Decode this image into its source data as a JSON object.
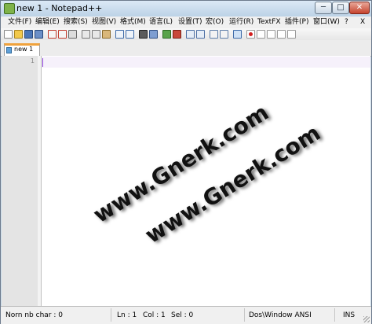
{
  "window": {
    "title": "new 1 - Notepad++"
  },
  "titlebar_buttons": {
    "minimize": "─",
    "maximize": "□",
    "close": "✕"
  },
  "menu": [
    "文件(F)",
    "编辑(E)",
    "搜索(S)",
    "视图(V)",
    "格式(M)",
    "语言(L)",
    "设置(T)",
    "宏(O)",
    "运行(R)",
    "TextFX",
    "插件(P)",
    "窗口(W)",
    "?",
    "X"
  ],
  "toolbar_icons": [
    "new-file-icon",
    "open-file-icon",
    "save-icon",
    "save-all-icon",
    "close-icon",
    "close-all-icon",
    "print-icon",
    "cut-icon",
    "copy-icon",
    "paste-icon",
    "undo-icon",
    "redo-icon",
    "find-icon",
    "replace-icon",
    "zoom-in-icon",
    "zoom-out-icon",
    "sync-vertical-icon",
    "sync-horizontal-icon",
    "word-wrap-icon",
    "all-chars-icon",
    "indent-guide-icon",
    "record-macro-icon",
    "stop-macro-icon",
    "play-macro-icon",
    "run-macro-multiple-icon",
    "save-macro-icon"
  ],
  "tab": {
    "label": "new 1"
  },
  "editor": {
    "line_number": "1",
    "content": ""
  },
  "watermark": [
    "www.Gnerk.com",
    "www.Gnerk.com"
  ],
  "status": {
    "chars": "Norn nb char : 0",
    "ln": "Ln : 1",
    "col": "Col : 1",
    "sel": "Sel : 0",
    "eol": "Dos\\Window ANSI",
    "mode": "INS"
  },
  "colors": {
    "accent_tab": "#f0a23c",
    "caret": "#8b3fd6",
    "close_button": "#c5432d"
  }
}
